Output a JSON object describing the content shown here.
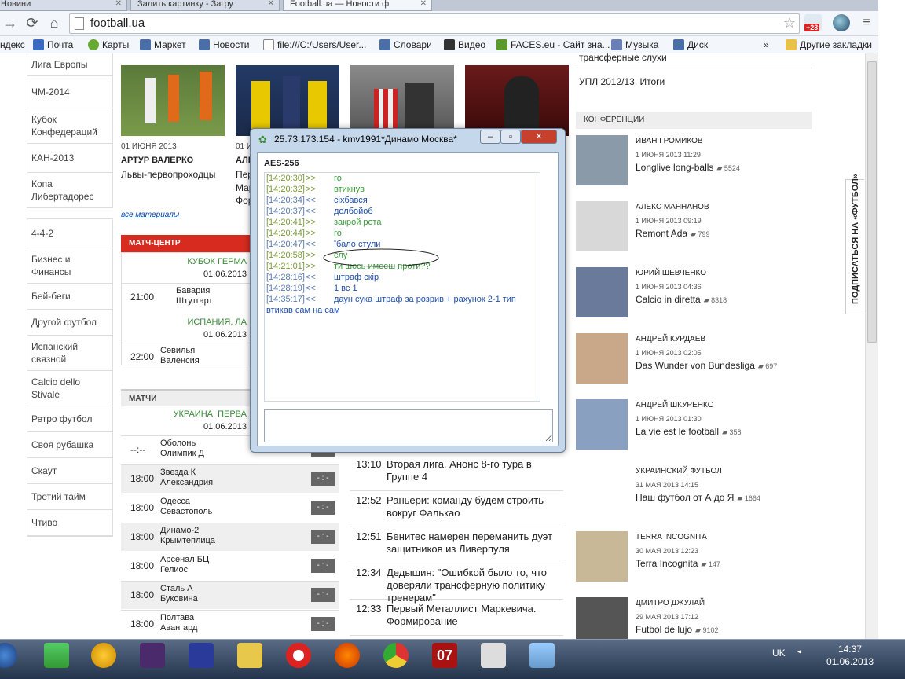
{
  "browser": {
    "tabs": [
      {
        "label": "Новини",
        "active": false
      },
      {
        "label": "Залить картинку - Загру",
        "active": false
      },
      {
        "label": "Football.ua — Новости ф",
        "active": true
      }
    ],
    "url": "football.ua",
    "ext_badge": "+23",
    "bookmarks": [
      "ндекс",
      "Почта",
      "Карты",
      "Маркет",
      "Новости",
      "file:///C:/Users/User...",
      "Словари",
      "Видео",
      "FACES.eu - Сайт зна...",
      "Музыка",
      "Диск"
    ],
    "bookmarks_more": "»",
    "bookmarks_other": "Другие закладки"
  },
  "leftnav": {
    "group1": [
      "Лига Европы",
      "ЧМ-2014",
      "Кубок Конфедераций",
      "КАН-2013",
      "Копа Либертадорес"
    ],
    "group2": [
      "4-4-2",
      "Бизнес и Финансы",
      "Бей-беги",
      "Другой футбол",
      "Испанский связной",
      "Calcio dello Stivale",
      "Ретро футбол",
      "Своя рубашка",
      "Скаут",
      "Третий тайм",
      "Чтиво"
    ]
  },
  "news": [
    {
      "date": "01 ИЮНЯ 2013",
      "author": "АРТУР ВАЛЕРКО",
      "title": "Львы-первопроходцы"
    },
    {
      "date": "01 И",
      "author": "АЛЕ",
      "title": "Пер"
    }
  ],
  "news_extra": [
    "Мар",
    "Фор"
  ],
  "all_materials": "все материалы",
  "match_center": {
    "title": "МАТЧ-ЦЕНТР",
    "leagues": [
      {
        "name": "КУБОК ГЕРМА",
        "date": "01.06.2013",
        "time": "21:00",
        "home": "Бавария",
        "away": "Штутгарт"
      },
      {
        "name": "ИСПАНИЯ. ЛА",
        "date": "01.06.2013",
        "time": "22:00",
        "home": "Севилья",
        "away": "Валенсия"
      }
    ]
  },
  "matches": {
    "title": "МАТЧИ",
    "league": "УКРАИНА. ПЕРВА",
    "date": "01.06.2013",
    "rows": [
      {
        "time": "--:--",
        "home": "Оболонь",
        "away": "Олимпик Д",
        "score": "- : -"
      },
      {
        "time": "18:00",
        "home": "Звезда К",
        "away": "Александрия",
        "score": "- : -"
      },
      {
        "time": "18:00",
        "home": "Одесса",
        "away": "Севастополь",
        "score": "- : -"
      },
      {
        "time": "18:00",
        "home": "Динамо-2",
        "away": "Крымтеплица",
        "score": "- : -"
      },
      {
        "time": "18:00",
        "home": "Арсенал БЦ",
        "away": "Гелиос",
        "score": "- : -"
      },
      {
        "time": "18:00",
        "home": "Сталь А",
        "away": "Буковина",
        "score": "- : -"
      },
      {
        "time": "18:00",
        "home": "Полтава",
        "away": "Авангард",
        "score": "- : -"
      }
    ]
  },
  "feed": [
    {
      "time": "13:10",
      "title": "Вторая лига. Анонс 8-го тура в Группе 4"
    },
    {
      "time": "12:52",
      "title": "Раньери: команду будем строить вокруг Фалькао"
    },
    {
      "time": "12:51",
      "title": "Бенитес намерен переманить дуэт защитников из Ливерпуля"
    },
    {
      "time": "12:34",
      "title": "Дедышин: \"Ошибкой было то, что доверяли трансферную политику тренерам\""
    },
    {
      "time": "12:33",
      "title": "Первый Металлист Маркевича. Формирование"
    }
  ],
  "right_links": [
    "трансферные слухи",
    "УПЛ 2012/13. Итоги"
  ],
  "conferences": {
    "title": "КОНФЕРЕНЦИИ",
    "items": [
      {
        "name": "ИВАН ГРОМИКОВ",
        "date": "1 ИЮНЯ 2013 11:29",
        "title": "Longlive long-balls",
        "comments": "5524"
      },
      {
        "name": "АЛЕКС МАННАНОВ",
        "date": "1 ИЮНЯ 2013 09:19",
        "title": "Remont Ada",
        "comments": "799"
      },
      {
        "name": "ЮРИЙ ШЕВЧЕНКО",
        "date": "1 ИЮНЯ 2013 04:36",
        "title": "Calcio in diretta",
        "comments": "8318"
      },
      {
        "name": "АНДРЕЙ КУРДАЕВ",
        "date": "1 ИЮНЯ 2013 02:05",
        "title": "Das Wunder von Bundesliga",
        "comments": "697"
      },
      {
        "name": "АНДРЕЙ ШКУРЕНКО",
        "date": "1 ИЮНЯ 2013 01:30",
        "title": "La vie est le football",
        "comments": "358"
      },
      {
        "name": "УКРАИНСКИЙ ФУТБОЛ",
        "date": "31 МАЯ 2013 14:15",
        "title": "Наш футбол от А до Я",
        "comments": "1664"
      },
      {
        "name": "TERRA INCOGNITA",
        "date": "30 МАЯ 2013 12:23",
        "title": "Terra Incognita",
        "comments": "147"
      },
      {
        "name": "ДМИТРО ДЖУЛАЙ",
        "date": "29 МАЯ 2013 17:12",
        "title": "Futbol de lujo",
        "comments": "9102"
      }
    ]
  },
  "subscribe": "ПОДПИСАТЬСЯ НА «ФУТБОЛ»",
  "chat": {
    "title": "25.73.173.154 - kmv1991*Динамо Москва*",
    "encryption": "AES-256",
    "messages": [
      {
        "time": "[14:20:30]",
        "dir": ">>",
        "text": "го",
        "kind": "out"
      },
      {
        "time": "[14:20:32]",
        "dir": ">>",
        "text": "втикнув",
        "kind": "out"
      },
      {
        "time": "[14:20:34]",
        "dir": "<<",
        "text": "сіхбався",
        "kind": "in"
      },
      {
        "time": "[14:20:37]",
        "dir": "<<",
        "text": "долбойоб",
        "kind": "in"
      },
      {
        "time": "[14:20:41]",
        "dir": ">>",
        "text": "закрой рота",
        "kind": "out"
      },
      {
        "time": "[14:20:44]",
        "dir": ">>",
        "text": "го",
        "kind": "out"
      },
      {
        "time": "[14:20:47]",
        "dir": "<<",
        "text": "їбало стули",
        "kind": "in"
      },
      {
        "time": "[14:20:58]",
        "dir": ">>",
        "text": "слу",
        "kind": "out"
      },
      {
        "time": "[14:21:01]",
        "dir": ">>",
        "text": "ти шось имееш проти??",
        "kind": "out"
      },
      {
        "time": "[14:28:16]",
        "dir": "<<",
        "text": "штраф скір",
        "kind": "in"
      },
      {
        "time": "[14:28:19]",
        "dir": "<<",
        "text": "1 вс 1",
        "kind": "in"
      },
      {
        "time": "[14:35:17]",
        "dir": "<<",
        "text": "даун сука штраф за розрив + рахунок 2-1 тип",
        "kind": "in"
      }
    ],
    "wrap_line": "втикав сам на сам",
    "input_value": ""
  },
  "taskbar": {
    "lang": "UK",
    "time": "14:37",
    "date": "01.06.2013"
  }
}
